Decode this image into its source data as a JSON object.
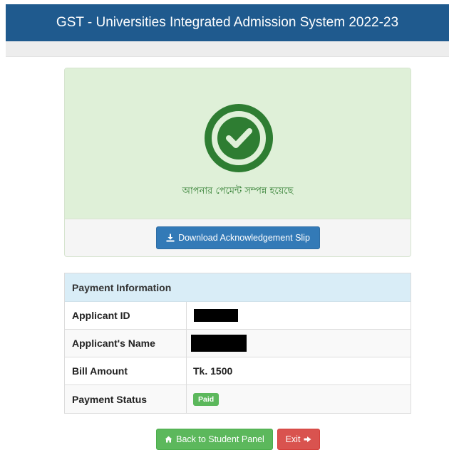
{
  "header": {
    "title": "GST - Universities Integrated Admission System 2022-23"
  },
  "success": {
    "icon": "check-circle-icon",
    "message": "আপনার পেমেন্ট সম্পন্ন হয়েছে",
    "download_label": "Download Acknowledgement Slip"
  },
  "payment_info": {
    "heading": "Payment Information",
    "rows": [
      {
        "label": "Applicant ID",
        "value": ""
      },
      {
        "label": "Applicant's Name",
        "value": ""
      },
      {
        "label": "Bill Amount",
        "value": "Tk. 1500"
      },
      {
        "label": "Payment Status",
        "value": "Paid"
      }
    ]
  },
  "actions": {
    "back_label": "Back to Student Panel",
    "exit_label": "Exit"
  },
  "colors": {
    "header_bg": "#1f5a8e",
    "success_bg": "#dff0d8",
    "success_icon": "#2e7d32",
    "primary_button": "#337ab7",
    "success_button": "#5cb85c",
    "danger_button": "#d9534f",
    "table_head_bg": "#d9edf7"
  }
}
